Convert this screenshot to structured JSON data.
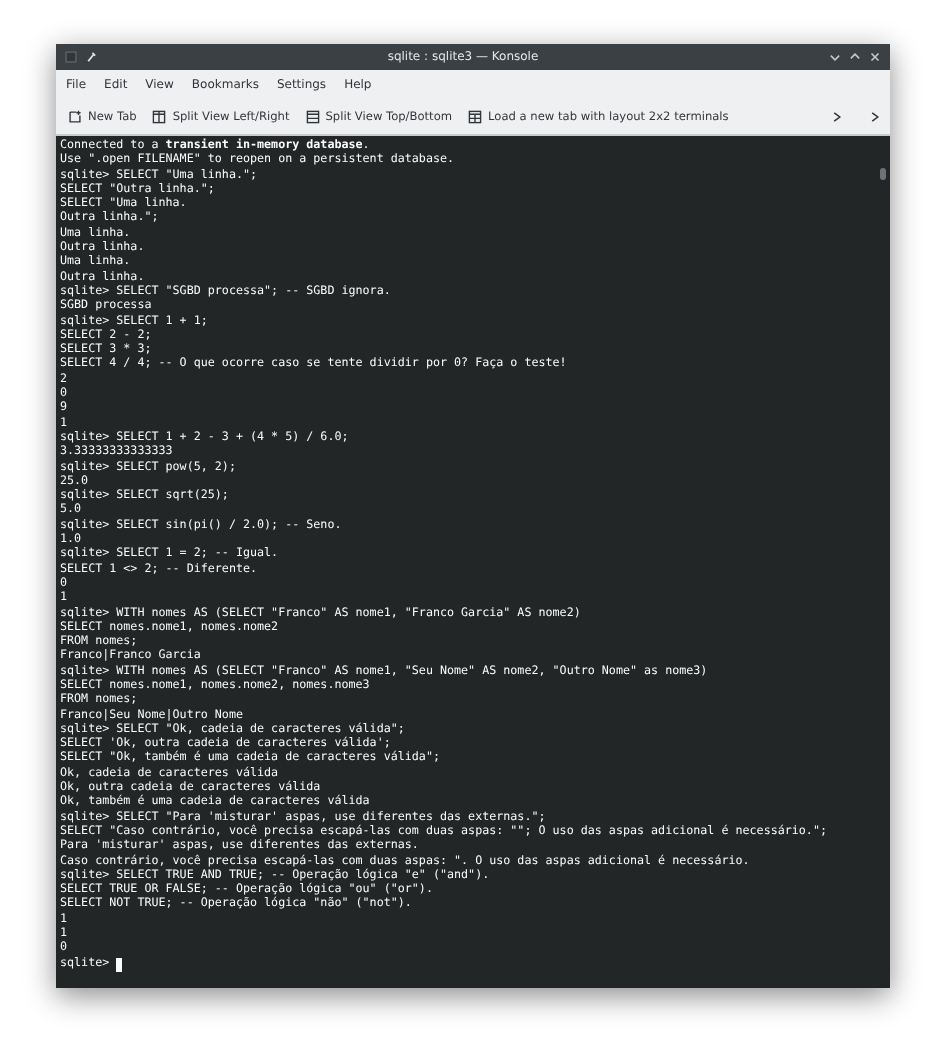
{
  "window": {
    "title": "sqlite : sqlite3 — Konsole"
  },
  "menu": [
    "File",
    "Edit",
    "View",
    "Bookmarks",
    "Settings",
    "Help"
  ],
  "toolbar": [
    {
      "label": "New Tab",
      "kind": "new-tab"
    },
    {
      "label": "Split View Left/Right",
      "kind": "split-lr"
    },
    {
      "label": "Split View Top/Bottom",
      "kind": "split-tb"
    },
    {
      "label": "Load a new tab with layout 2x2 terminals",
      "kind": "grid"
    }
  ],
  "terminal": {
    "lines": [
      "Connected to a **transient in-memory database**.",
      "Use \".open FILENAME\" to reopen on a persistent database.",
      "sqlite> SELECT \"Uma linha.\";",
      "SELECT \"Outra linha.\";",
      "SELECT \"Uma linha.",
      "Outra linha.\";",
      "Uma linha.",
      "Outra linha.",
      "Uma linha.",
      "Outra linha.",
      "sqlite> SELECT \"SGBD processa\"; -- SGBD ignora.",
      "SGBD processa",
      "sqlite> SELECT 1 + 1;",
      "SELECT 2 - 2;",
      "SELECT 3 * 3;",
      "SELECT 4 / 4; -- O que ocorre caso se tente dividir por 0? Faça o teste!",
      "2",
      "0",
      "9",
      "1",
      "sqlite> SELECT 1 + 2 - 3 + (4 * 5) / 6.0;",
      "3.33333333333333",
      "sqlite> SELECT pow(5, 2);",
      "25.0",
      "sqlite> SELECT sqrt(25);",
      "5.0",
      "sqlite> SELECT sin(pi() / 2.0); -- Seno.",
      "1.0",
      "sqlite> SELECT 1 = 2; -- Igual.",
      "SELECT 1 <> 2; -- Diferente.",
      "0",
      "1",
      "sqlite> WITH nomes AS (SELECT \"Franco\" AS nome1, \"Franco Garcia\" AS nome2)",
      "SELECT nomes.nome1, nomes.nome2",
      "FROM nomes;",
      "Franco|Franco Garcia",
      "sqlite> WITH nomes AS (SELECT \"Franco\" AS nome1, \"Seu Nome\" AS nome2, \"Outro Nome\" as nome3)",
      "SELECT nomes.nome1, nomes.nome2, nomes.nome3",
      "FROM nomes;",
      "Franco|Seu Nome|Outro Nome",
      "sqlite> SELECT \"Ok, cadeia de caracteres válida\";",
      "SELECT 'Ok, outra cadeia de caracteres válida';",
      "SELECT \"Ok, também é uma cadeia de caracteres válida\";",
      "Ok, cadeia de caracteres válida",
      "Ok, outra cadeia de caracteres válida",
      "Ok, também é uma cadeia de caracteres válida",
      "sqlite> SELECT \"Para 'misturar' aspas, use diferentes das externas.\";",
      "SELECT \"Caso contrário, você precisa escapá-las com duas aspas: \"\"; O uso das aspas adicional é necessário.\";",
      "Para 'misturar' aspas, use diferentes das externas.",
      "Caso contrário, você precisa escapá-las com duas aspas: \". O uso das aspas adicional é necessário.",
      "sqlite> SELECT TRUE AND TRUE; -- Operação lógica \"e\" (\"and\").",
      "SELECT TRUE OR FALSE; -- Operação lógica \"ou\" (\"or\").",
      "SELECT NOT TRUE; -- Operação lógica \"não\" (\"not\").",
      "1",
      "1",
      "0"
    ],
    "prompt": "sqlite>"
  }
}
